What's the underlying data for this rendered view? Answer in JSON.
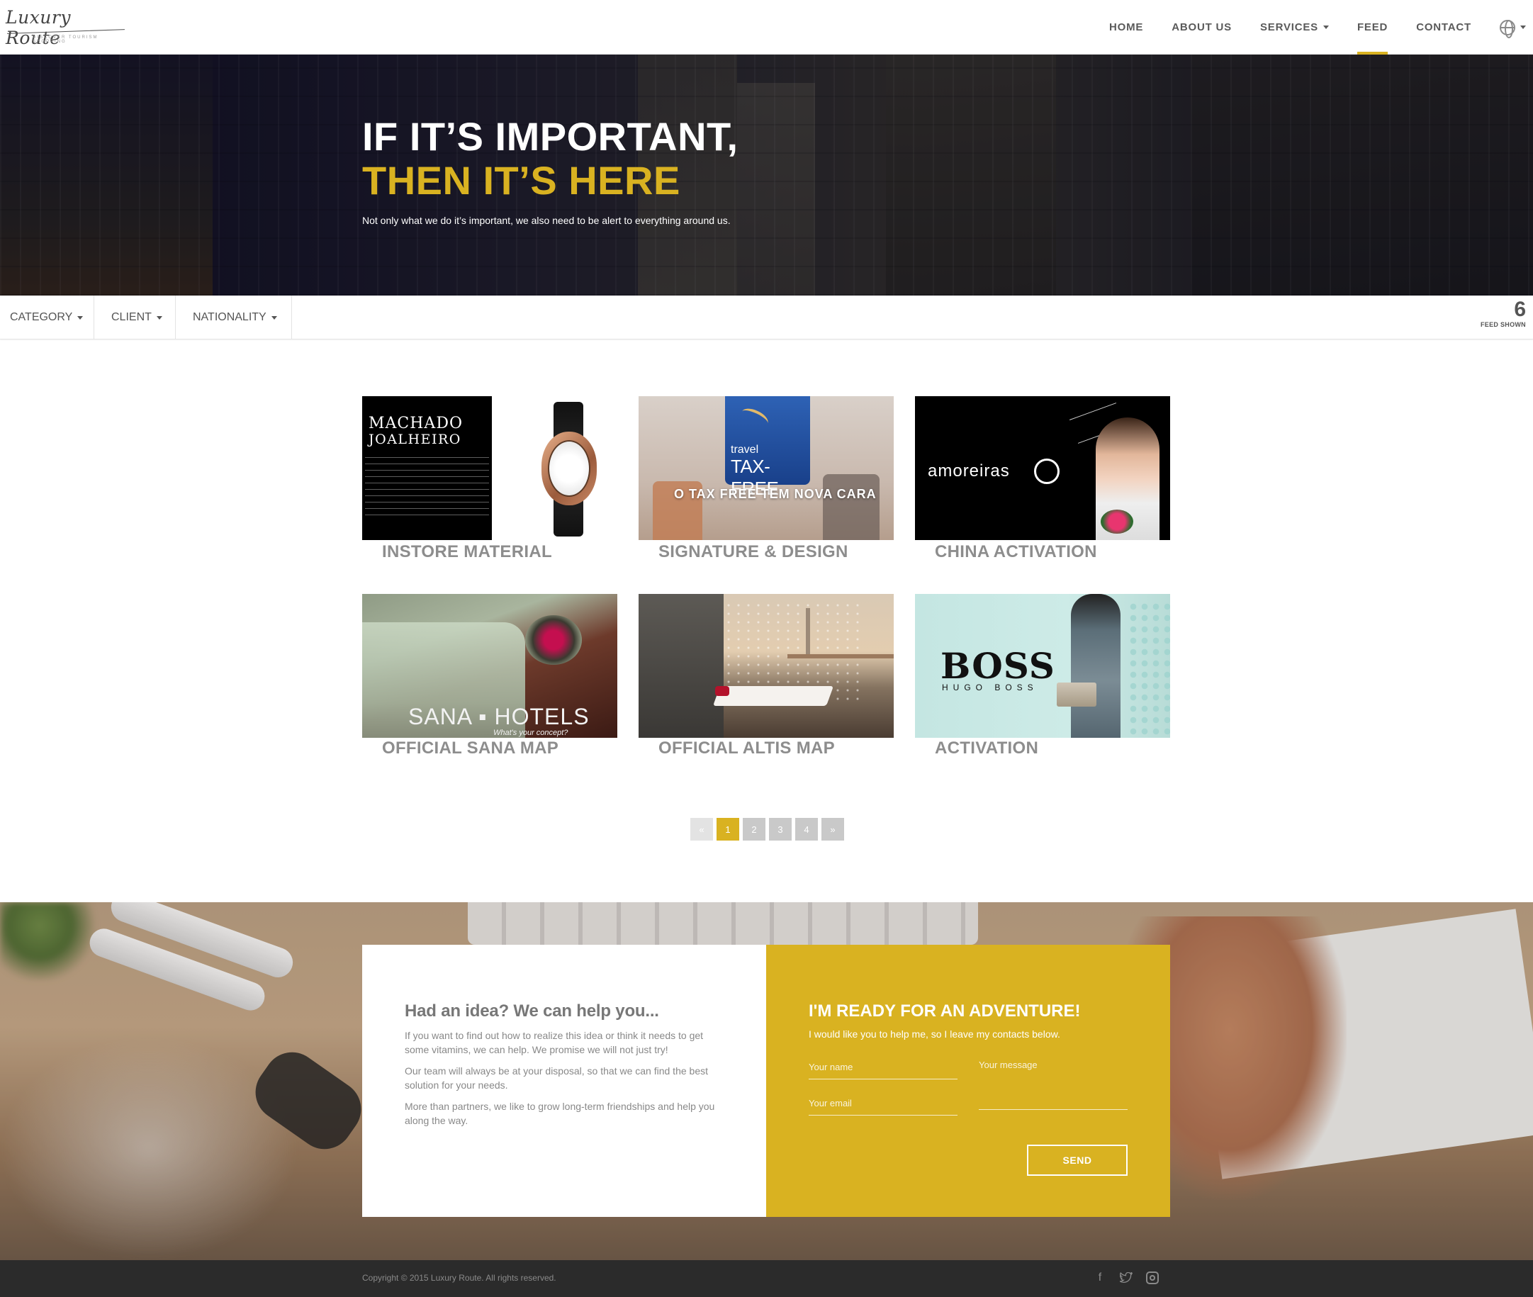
{
  "nav": {
    "logo_text": "Luxury Route",
    "logo_tagline": "DISCOVER TOURISM SHOPPING",
    "items": [
      {
        "label": "HOME"
      },
      {
        "label": "ABOUT US"
      },
      {
        "label": "SERVICES"
      },
      {
        "label": "FEED"
      },
      {
        "label": "CONTACT"
      }
    ],
    "active_item": "FEED",
    "language_icon": "globe-icon",
    "accent_color": "#d9b221"
  },
  "hero": {
    "title_line1": "IF IT’S IMPORTANT,",
    "title_line2": "THEN IT’S HERE",
    "subtitle": "Not only what we do it’s important, we also need to be alert to everything around us."
  },
  "filters": {
    "category": "CATEGORY",
    "client": "CLIENT",
    "nationality": "NATIONALITY",
    "count": "6",
    "count_label": "FEED SHOWN"
  },
  "feed": [
    {
      "title": "INSTORE MATERIAL",
      "image_text1": "MACHADO",
      "image_text2": "JOALHEIRO"
    },
    {
      "title": "SIGNATURE & DESIGN",
      "image_text1": "travel",
      "image_text2": "TAX-FREE",
      "image_text3": "O TAX FREE TEM NOVA CARA"
    },
    {
      "title": "CHINA ACTIVATION",
      "image_text1": "amoreiras"
    },
    {
      "title": "OFFICIAL SANA MAP",
      "image_text1": "SANA ▪ HOTELS",
      "image_text2": "What's your concept?"
    },
    {
      "title": "OFFICIAL ALTIS MAP"
    },
    {
      "title": "ACTIVATION",
      "image_text1": "BOSS",
      "image_text2": "HUGO BOSS"
    }
  ],
  "pagination": {
    "prev": "«",
    "pages": [
      "1",
      "2",
      "3",
      "4"
    ],
    "next": "»",
    "current": "1"
  },
  "contact": {
    "left_title": "Had an idea? We can help you...",
    "left_p1": "If you want to find out how to realize this idea or think it needs to get some vitamins, we can help. We promise we will not just try!",
    "left_p2": "Our team will always be at your disposal, so that we can find the best solution for your needs.",
    "left_p3": "More than partners, we like to grow long-term friendships and help you along the way.",
    "right_title": "I'M READY FOR AN ADVENTURE!",
    "right_sub": "I would like you to help me, so I leave my contacts below.",
    "name_placeholder": "Your name",
    "email_placeholder": "Your email",
    "message_placeholder": "Your message",
    "send_label": "SEND"
  },
  "footer": {
    "copyright": "Copyright © 2015 Luxury Route. All rights reserved.",
    "social": [
      "facebook-icon",
      "twitter-icon",
      "instagram-icon"
    ]
  }
}
